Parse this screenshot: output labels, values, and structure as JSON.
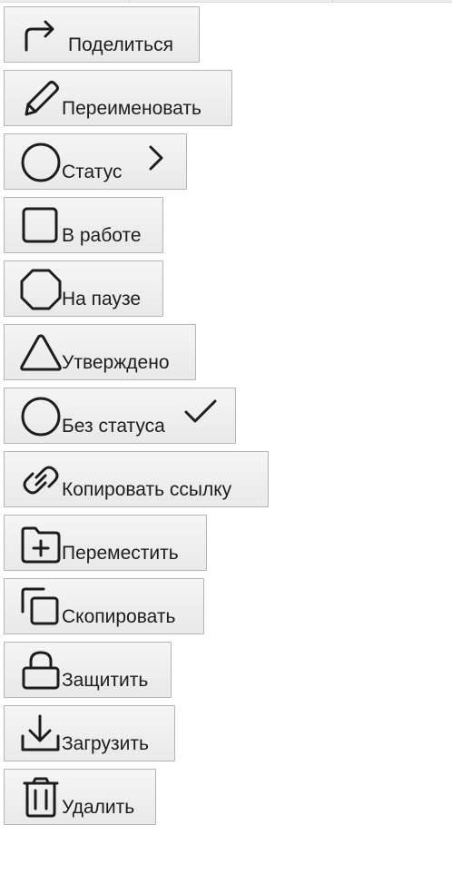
{
  "menu": {
    "share": {
      "label": "Поделиться",
      "icon": "share-arrow-icon"
    },
    "rename": {
      "label": "Переименовать",
      "icon": "pencil-icon"
    },
    "status": {
      "label": "Статус",
      "icon": "circle-icon",
      "trailing_icon": "chevron-right-icon"
    },
    "in_progress": {
      "label": "В работе",
      "icon": "square-icon"
    },
    "paused": {
      "label": "На паузе",
      "icon": "octagon-icon"
    },
    "approved": {
      "label": "Утверждено",
      "icon": "triangle-icon"
    },
    "no_status": {
      "label": "Без статуса",
      "icon": "circle-icon",
      "trailing_icon": "checkmark-icon"
    },
    "copy_link": {
      "label": "Копировать ссылку",
      "icon": "link-icon"
    },
    "move": {
      "label": "Переместить",
      "icon": "folder-plus-icon"
    },
    "duplicate": {
      "label": "Скопировать",
      "icon": "copy-icon"
    },
    "protect": {
      "label": "Защитить",
      "icon": "lock-icon"
    },
    "download": {
      "label": "Загрузить",
      "icon": "download-icon"
    },
    "delete": {
      "label": "Удалить",
      "icon": "trash-icon"
    }
  }
}
